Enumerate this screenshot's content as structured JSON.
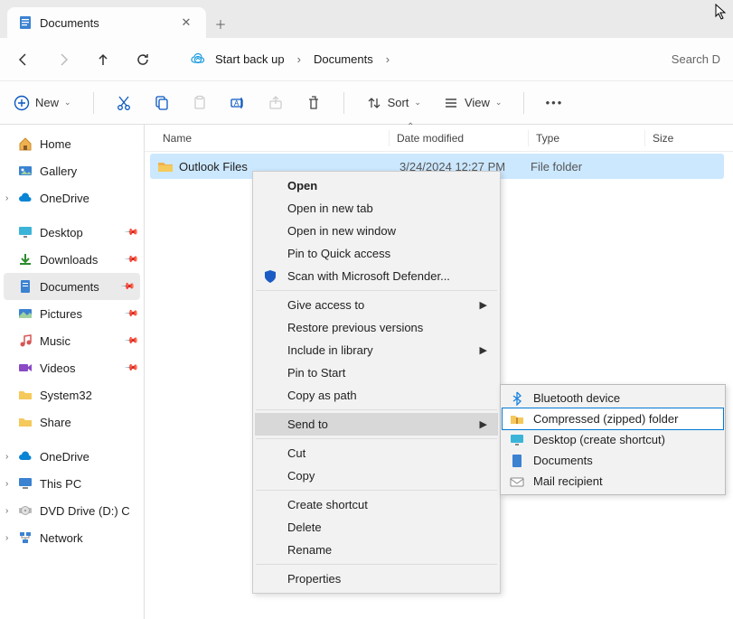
{
  "tab": {
    "title": "Documents"
  },
  "breadcrumb": {
    "backup": "Start back up",
    "current": "Documents"
  },
  "search": {
    "placeholder": "Search D"
  },
  "toolbar": {
    "new": "New",
    "sort": "Sort",
    "view": "View"
  },
  "sidebar": {
    "home": "Home",
    "gallery": "Gallery",
    "onedrive": "OneDrive",
    "desktop": "Desktop",
    "downloads": "Downloads",
    "documents": "Documents",
    "pictures": "Pictures",
    "music": "Music",
    "videos": "Videos",
    "system32": "System32",
    "share": "Share",
    "onedrive2": "OneDrive",
    "thispc": "This PC",
    "dvd": "DVD Drive (D:) C",
    "network": "Network"
  },
  "columns": {
    "name": "Name",
    "date": "Date modified",
    "type": "Type",
    "size": "Size"
  },
  "file": {
    "name": "Outlook Files",
    "date": "3/24/2024 12:27 PM",
    "type": "File folder"
  },
  "context": {
    "open": "Open",
    "newtab": "Open in new tab",
    "newwin": "Open in new window",
    "pin_quick": "Pin to Quick access",
    "defender": "Scan with Microsoft Defender...",
    "give_access": "Give access to",
    "restore": "Restore previous versions",
    "include": "Include in library",
    "pin_start": "Pin to Start",
    "copy_path": "Copy as path",
    "send_to": "Send to",
    "cut": "Cut",
    "copy": "Copy",
    "shortcut": "Create shortcut",
    "delete": "Delete",
    "rename": "Rename",
    "properties": "Properties"
  },
  "submenu": {
    "bt": "Bluetooth device",
    "zip": "Compressed (zipped) folder",
    "desktop": "Desktop (create shortcut)",
    "docs": "Documents",
    "mail": "Mail recipient"
  }
}
